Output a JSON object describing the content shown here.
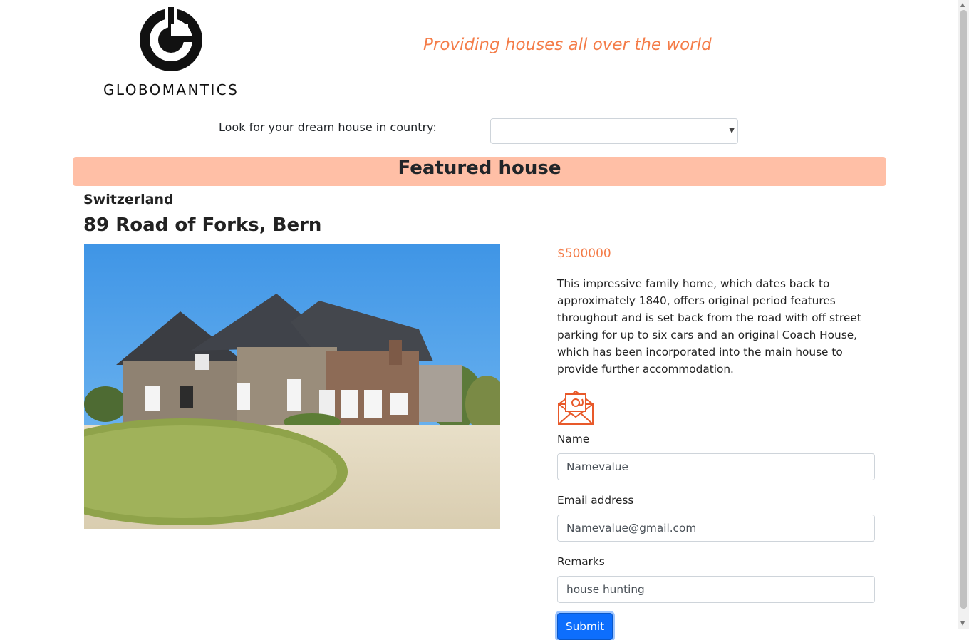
{
  "brand": {
    "name": "GLOBOMANTICS"
  },
  "header": {
    "tagline": "Providing houses all over the world"
  },
  "search": {
    "label": "Look for your dream house in country:",
    "selected": ""
  },
  "featured": {
    "title": "Featured house",
    "country": "Switzerland",
    "address": "89 Road of Forks, Bern",
    "price": "$500000",
    "description": "This impressive family home, which dates back to approximately 1840, offers original period features throughout and is set back from the road with off street parking for up to six cars and an original Coach House, which has been incorporated into the main house to provide further accommodation."
  },
  "form": {
    "name_label": "Name",
    "name_value": "Namevalue",
    "email_label": "Email address",
    "email_value": "Namevalue@gmail.com",
    "remarks_label": "Remarks",
    "remarks_value": "house hunting",
    "submit_label": "Submit"
  },
  "icons": {
    "mail": "envelope-at-icon",
    "logo": "globomantics-g-logo"
  },
  "colors": {
    "accent": "#f47c48",
    "featured_bar": "#ffbfa6",
    "primary_button": "#0d6efd"
  }
}
